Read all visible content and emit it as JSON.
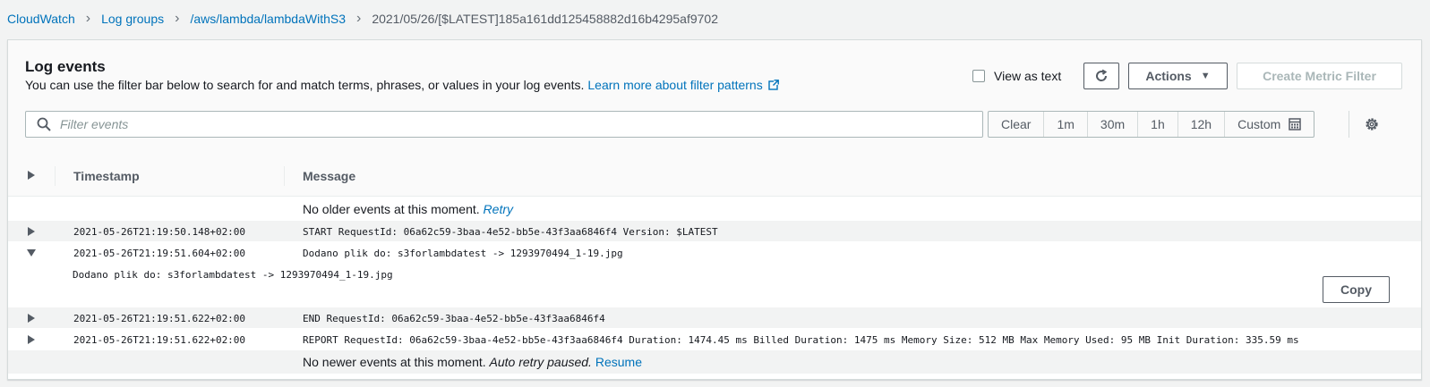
{
  "breadcrumb": {
    "items": [
      "CloudWatch",
      "Log groups",
      "/aws/lambda/lambdaWithS3"
    ],
    "current": "2021/05/26/[$LATEST]185a161dd125458882d16b4295af9702"
  },
  "header": {
    "title": "Log events",
    "description": "You can use the filter bar below to search for and match terms, phrases, or values in your log events.",
    "learn_more": "Learn more about filter patterns",
    "view_as_text": "View as text",
    "actions_label": "Actions",
    "create_metric_filter": "Create Metric Filter"
  },
  "filter": {
    "placeholder": "Filter events",
    "value": ""
  },
  "time_range": {
    "clear": "Clear",
    "options": [
      "1m",
      "30m",
      "1h",
      "12h"
    ],
    "custom": "Custom"
  },
  "table": {
    "col_timestamp": "Timestamp",
    "col_message": "Message",
    "no_older": "No older events at this moment.",
    "retry": "Retry",
    "rows": [
      {
        "timestamp": "2021-05-26T21:19:50.148+02:00",
        "message": "START RequestId: 06a62c59-3baa-4e52-bb5e-43f3aa6846f4 Version: $LATEST"
      },
      {
        "timestamp": "2021-05-26T21:19:51.604+02:00",
        "message": "Dodano plik do: s3forlambdatest -> 1293970494_1-19.jpg",
        "expanded_text": "Dodano plik do: s3forlambdatest -> 1293970494_1-19.jpg"
      },
      {
        "timestamp": "2021-05-26T21:19:51.622+02:00",
        "message": "END RequestId: 06a62c59-3baa-4e52-bb5e-43f3aa6846f4"
      },
      {
        "timestamp": "2021-05-26T21:19:51.622+02:00",
        "message": "REPORT RequestId: 06a62c59-3baa-4e52-bb5e-43f3aa6846f4 Duration: 1474.45 ms Billed Duration: 1475 ms Memory Size: 512 MB Max Memory Used: 95 MB Init Duration: 335.59 ms"
      }
    ],
    "copy_label": "Copy",
    "no_newer": "No newer events at this moment.",
    "auto_retry": "Auto retry paused.",
    "resume": "Resume"
  },
  "colors": {
    "link": "#0073bb",
    "text": "#16191f",
    "muted": "#545b64",
    "background": "#f2f3f3"
  },
  "icons": [
    "chevron-right-icon",
    "external-link-icon",
    "refresh-icon",
    "caret-down-icon",
    "search-icon",
    "calendar-icon",
    "gear-icon",
    "expand-triangle-icon",
    "collapse-triangle-icon"
  ]
}
